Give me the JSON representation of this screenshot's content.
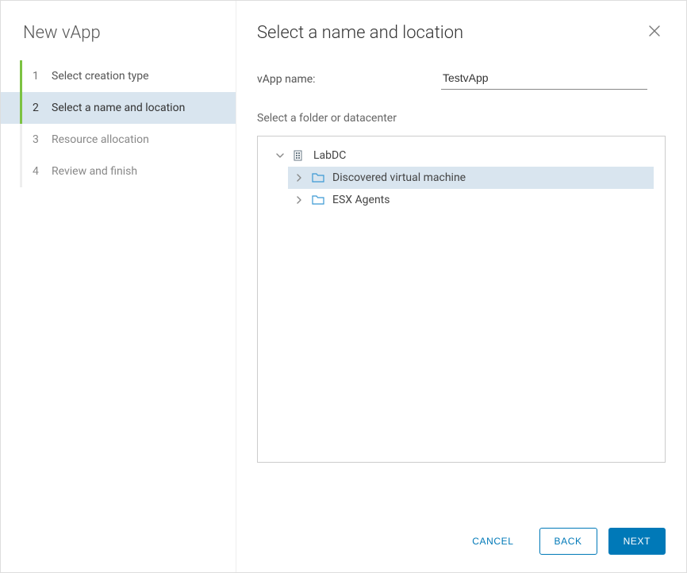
{
  "sidebar": {
    "title": "New vApp",
    "steps": [
      {
        "num": "1",
        "label": "Select creation type",
        "state": "completed"
      },
      {
        "num": "2",
        "label": "Select a name and location",
        "state": "active"
      },
      {
        "num": "3",
        "label": "Resource allocation",
        "state": "pending"
      },
      {
        "num": "4",
        "label": "Review and finish",
        "state": "pending"
      }
    ]
  },
  "main": {
    "title": "Select a name and location",
    "vapp_name_label": "vApp name:",
    "vapp_name_value": "TestvApp",
    "folder_section_label": "Select a folder or datacenter",
    "tree": {
      "root": {
        "label": "LabDC",
        "expanded": true
      },
      "children": [
        {
          "label": "Discovered virtual machine",
          "selected": true,
          "expandable": true
        },
        {
          "label": "ESX Agents",
          "selected": false,
          "expandable": true
        }
      ]
    }
  },
  "footer": {
    "cancel": "CANCEL",
    "back": "BACK",
    "next": "NEXT"
  }
}
